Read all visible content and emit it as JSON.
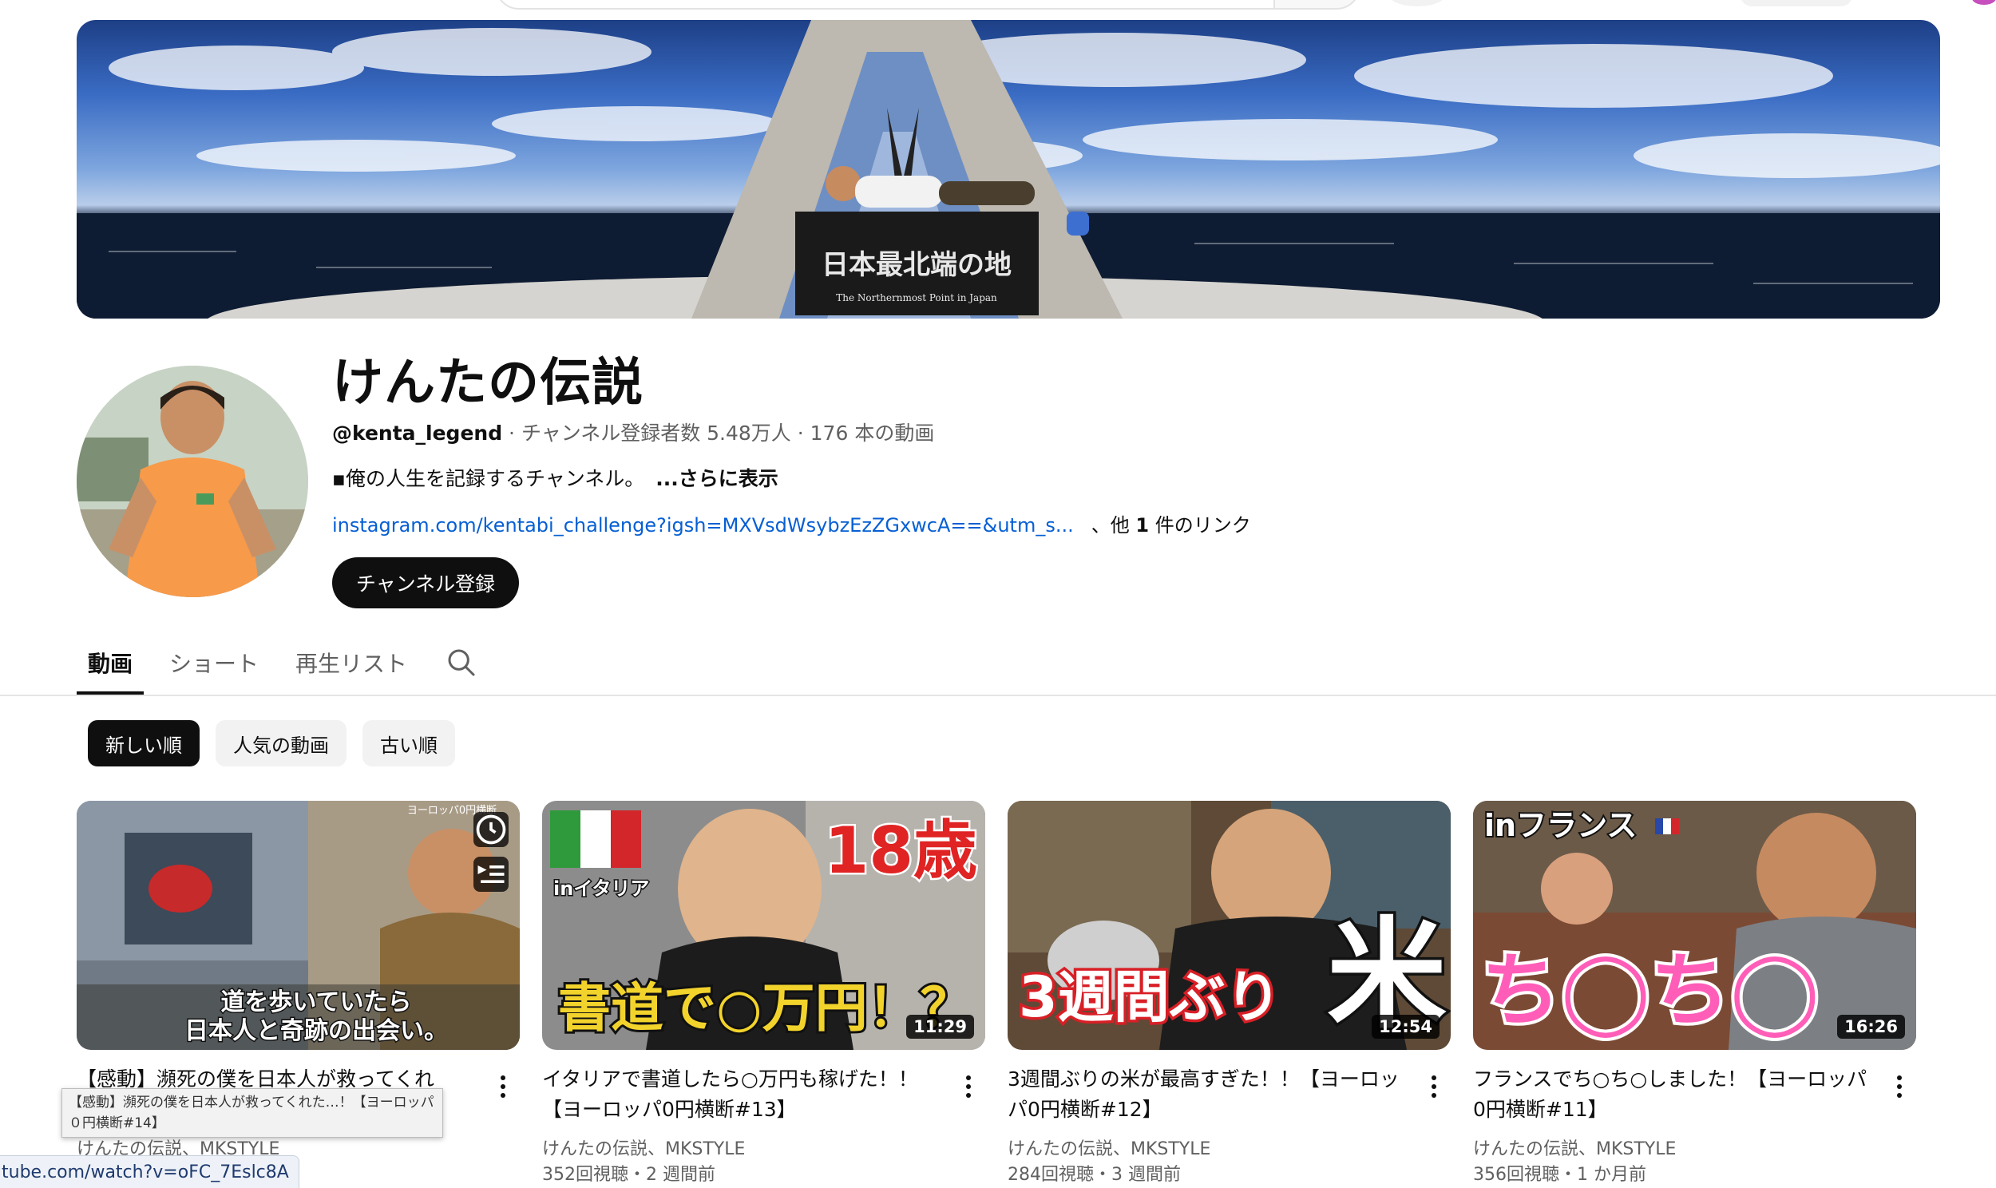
{
  "banner": {
    "sign_main": "日本最北端の地",
    "sign_sub": "The Northernmost Point in Japan"
  },
  "channel": {
    "name": "けんたの伝説",
    "handle": "@kenta_legend",
    "meta": " · チャンネル登録者数 5.48万人 · 176 本の動画",
    "description": "▪︎俺の人生を記録するチャンネル。",
    "description_more": "...さらに表示",
    "link_url": "instagram.com/kentabi_challenge?igsh=MXVsdWsybzEzZGxwcA==&utm_s...",
    "link_other_prefix": "、他 ",
    "link_other_count": "1",
    "link_other_suffix": " 件のリンク",
    "subscribe_label": "チャンネル登録"
  },
  "tabs": [
    {
      "label": "動画",
      "active": true
    },
    {
      "label": "ショート"
    },
    {
      "label": "再生リスト"
    }
  ],
  "icons": {
    "tab_search": "search-icon",
    "watch_later": "clock-icon",
    "add_queue": "queue-icon",
    "video_menu": "more-vert-icon"
  },
  "chips": [
    {
      "label": "新しい順",
      "selected": true
    },
    {
      "label": "人気の動画"
    },
    {
      "label": "古い順"
    }
  ],
  "videos": [
    {
      "title": "【感動】瀕死の僕を日本人が救ってくれ",
      "channel": "けんたの伝説、MKSTYLE",
      "stats": "",
      "duration": "",
      "thumb_text": [
        "道を歩いていたら",
        "日本人と奇跡の出会い。"
      ],
      "corner_text": "ヨーロッパ0円横断"
    },
    {
      "title": "イタリアで書道したら○万円も稼げた！！【ヨーロッパ0円横断#13】",
      "channel": "けんたの伝説、MKSTYLE",
      "stats": "352回視聴・2 週間前",
      "duration": "11:29",
      "thumb_text": [
        "18歳",
        "inイタリア",
        "書道で○万円！？"
      ]
    },
    {
      "title": "3週間ぶりの米が最高すぎた！！【ヨーロッパ0円横断#12】",
      "channel": "けんたの伝説、MKSTYLE",
      "stats": "284回視聴・3 週間前",
      "duration": "12:54",
      "thumb_text": [
        "3週間ぶり",
        "米"
      ]
    },
    {
      "title": "フランスでち○ち○しました！【ヨーロッパ0円横断#11】",
      "channel": "けんたの伝説、MKSTYLE",
      "stats": "356回視聴・1 か月前",
      "duration": "16:26",
      "thumb_text": [
        "inフランス",
        "ち◯ち◯"
      ]
    }
  ],
  "tooltip": "【感動】瀕死の僕を日本人が救ってくれた…！【ヨーロッパ０円横断#14】",
  "status_bar": "tube.com/watch?v=oFC_7Eslc8A",
  "colors": {
    "link": "#065fd4",
    "text_primary": "#0f0f0f",
    "text_secondary": "#606060",
    "chip_bg": "#f2f2f2",
    "button_dark": "#0f0f0f"
  }
}
